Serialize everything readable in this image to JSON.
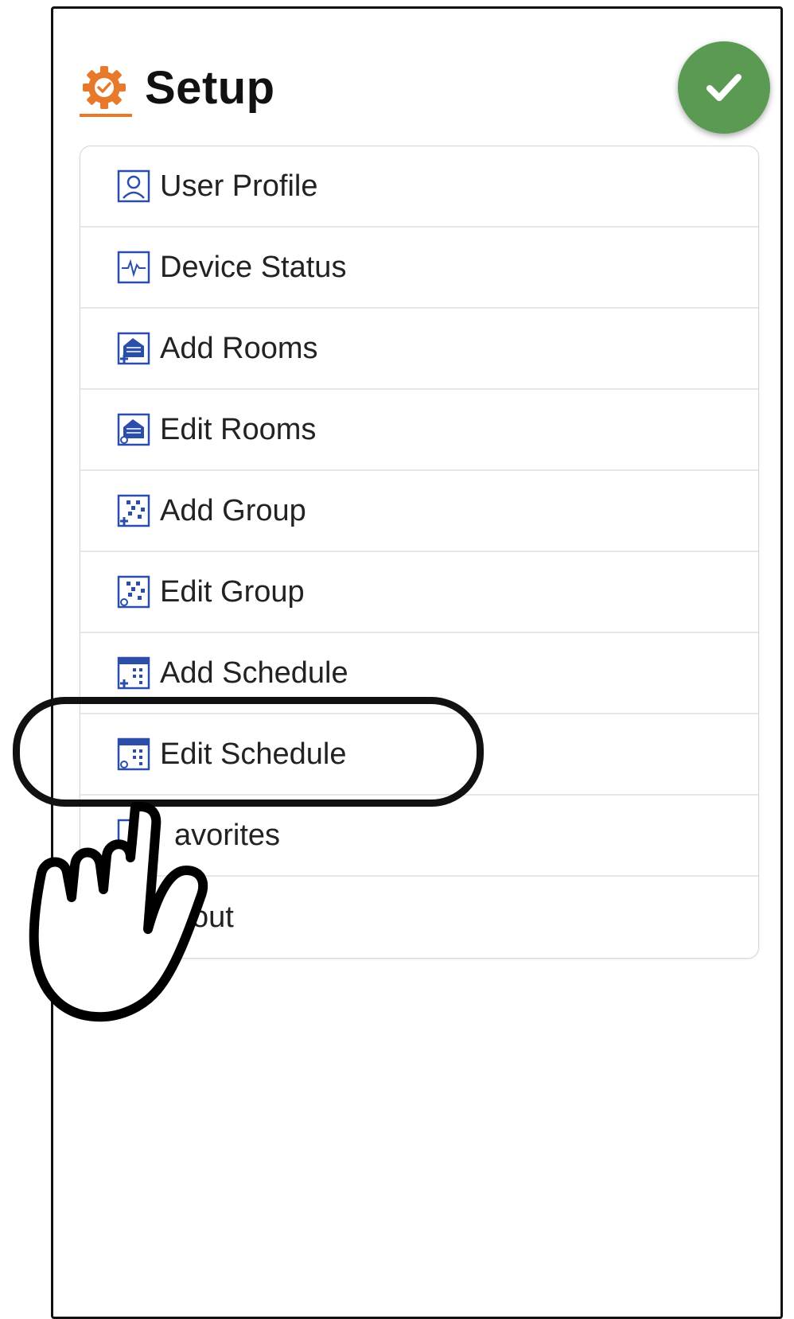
{
  "header": {
    "title": "Setup",
    "icon": "gear-check-icon"
  },
  "colors": {
    "accent": "#e8792a",
    "done": "#5a9a52",
    "icon_blue": "#2b4fa8"
  },
  "menu": {
    "items": [
      {
        "label": "User Profile",
        "icon": "user-profile-icon"
      },
      {
        "label": "Device Status",
        "icon": "device-status-icon"
      },
      {
        "label": "Add Rooms",
        "icon": "add-rooms-icon"
      },
      {
        "label": "Edit Rooms",
        "icon": "edit-rooms-icon"
      },
      {
        "label": "Add Group",
        "icon": "add-group-icon"
      },
      {
        "label": "Edit Group",
        "icon": "edit-group-icon"
      },
      {
        "label": "Add Schedule",
        "icon": "add-schedule-icon"
      },
      {
        "label": "Edit Schedule",
        "icon": "edit-schedule-icon"
      },
      {
        "label": "avorites",
        "icon": "favorites-icon"
      },
      {
        "label": "out",
        "icon": "logout-icon"
      }
    ]
  },
  "overlay": {
    "highlighted_item": "Edit Schedule",
    "pointer": "hand-pointer-icon"
  }
}
